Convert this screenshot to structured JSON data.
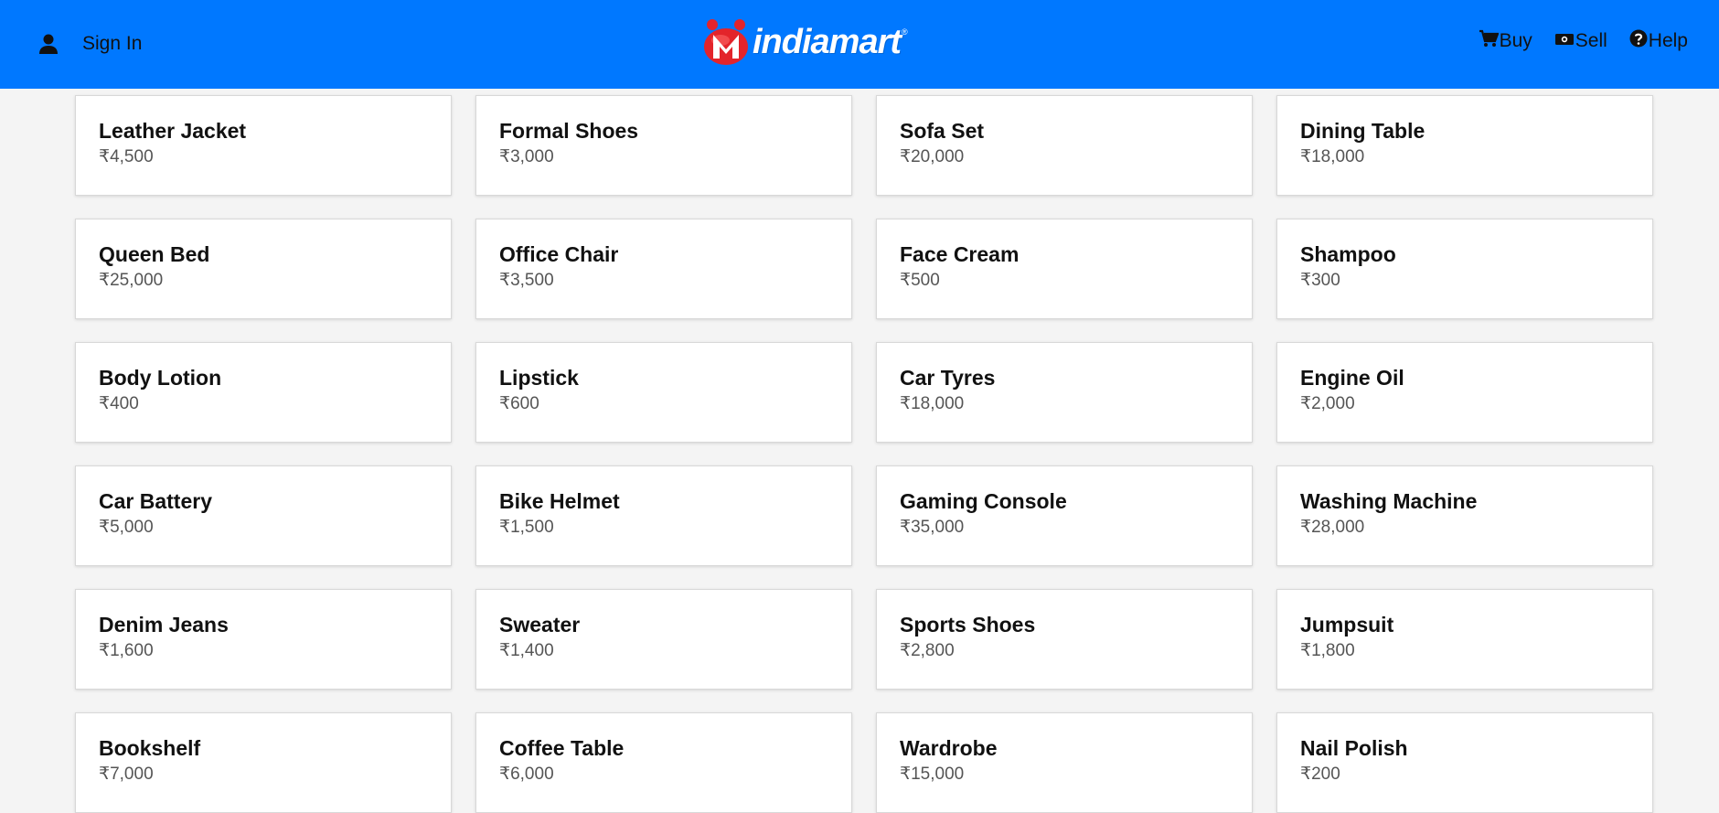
{
  "header": {
    "sign_in": "Sign In",
    "logo_text": "indiamart",
    "logo_reg": "®",
    "nav": {
      "buy": "Buy",
      "sell": "Sell",
      "help": "Help"
    },
    "colors": {
      "bar": "#0078ff",
      "logo_red": "#e3242b"
    },
    "icons": [
      "user-icon",
      "cart-icon",
      "money-icon",
      "question-circle-icon"
    ]
  },
  "products": [
    {
      "name": "Leather Jacket",
      "price": "₹4,500"
    },
    {
      "name": "Formal Shoes",
      "price": "₹3,000"
    },
    {
      "name": "Sofa Set",
      "price": "₹20,000"
    },
    {
      "name": "Dining Table",
      "price": "₹18,000"
    },
    {
      "name": "Queen Bed",
      "price": "₹25,000"
    },
    {
      "name": "Office Chair",
      "price": "₹3,500"
    },
    {
      "name": "Face Cream",
      "price": "₹500"
    },
    {
      "name": "Shampoo",
      "price": "₹300"
    },
    {
      "name": "Body Lotion",
      "price": "₹400"
    },
    {
      "name": "Lipstick",
      "price": "₹600"
    },
    {
      "name": "Car Tyres",
      "price": "₹18,000"
    },
    {
      "name": "Engine Oil",
      "price": "₹2,000"
    },
    {
      "name": "Car Battery",
      "price": "₹5,000"
    },
    {
      "name": "Bike Helmet",
      "price": "₹1,500"
    },
    {
      "name": "Gaming Console",
      "price": "₹35,000"
    },
    {
      "name": "Washing Machine",
      "price": "₹28,000"
    },
    {
      "name": "Denim Jeans",
      "price": "₹1,600"
    },
    {
      "name": "Sweater",
      "price": "₹1,400"
    },
    {
      "name": "Sports Shoes",
      "price": "₹2,800"
    },
    {
      "name": "Jumpsuit",
      "price": "₹1,800"
    },
    {
      "name": "Bookshelf",
      "price": "₹7,000"
    },
    {
      "name": "Coffee Table",
      "price": "₹6,000"
    },
    {
      "name": "Wardrobe",
      "price": "₹15,000"
    },
    {
      "name": "Nail Polish",
      "price": "₹200"
    }
  ]
}
